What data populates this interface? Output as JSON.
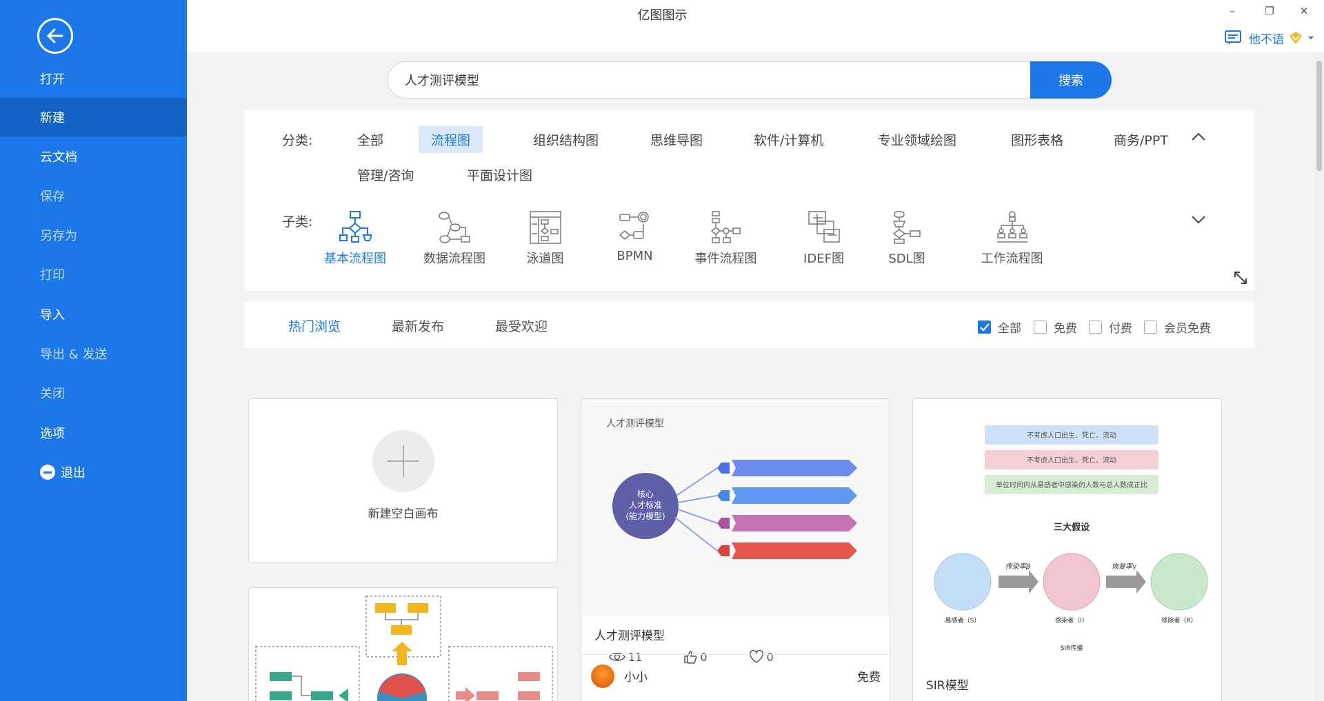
{
  "window": {
    "title": "亿图图示",
    "minimize": "–",
    "restore": "❐",
    "close": "✕"
  },
  "user": {
    "name": "他不语"
  },
  "sidebar": {
    "items": [
      {
        "label": "打开"
      },
      {
        "label": "新建"
      },
      {
        "label": "云文档"
      },
      {
        "label": "保存"
      },
      {
        "label": "另存为"
      },
      {
        "label": "打印"
      },
      {
        "label": "导入"
      },
      {
        "label": "导出 & 发送"
      },
      {
        "label": "关闭"
      },
      {
        "label": "选项"
      },
      {
        "label": "退出"
      }
    ]
  },
  "search": {
    "value": "人才测评模型",
    "button": "搜索"
  },
  "categories": {
    "label": "分类:",
    "items": [
      "全部",
      "流程图",
      "组织结构图",
      "思维导图",
      "软件/计算机",
      "专业领域绘图",
      "图形表格",
      "商务/PPT",
      "管理/咨询",
      "平面设计图"
    ],
    "active": "流程图",
    "sub_label": "子类:",
    "sub_items": [
      "基本流程图",
      "数据流程图",
      "泳道图",
      "BPMN",
      "事件流程图",
      "IDEF图",
      "SDL图",
      "工作流程图"
    ],
    "sub_active": "基本流程图"
  },
  "sort": {
    "tabs": [
      "热门浏览",
      "最新发布",
      "最受欢迎"
    ],
    "filters": [
      {
        "label": "全部",
        "checked": true
      },
      {
        "label": "免费",
        "checked": false
      },
      {
        "label": "付费",
        "checked": false
      },
      {
        "label": "会员免费",
        "checked": false
      }
    ]
  },
  "cards": {
    "new_blank": "新建空白画布",
    "talent": {
      "title": "人才测评模型",
      "preview_title": "人才测评模型",
      "center_text": [
        "核心",
        "人才标准",
        "(能力模型)"
      ],
      "views": "11",
      "likes": "0",
      "favorites": "0",
      "author": "小小",
      "price": "免费"
    },
    "sir": {
      "title": "SIR模型",
      "banners": [
        "不考虑人口出生、死亡、流动",
        "不考虑人口出生、死亡、流动",
        "单位时间内从易感者中感染的人数与总人数成正比"
      ],
      "heading": "三大假设",
      "arrow1": "传染率β",
      "arrow2": "恢复率γ",
      "nodes": [
        "易感者（S）",
        "感染者（I）",
        "移除者（R）"
      ],
      "footer": "SIR传播"
    }
  }
}
